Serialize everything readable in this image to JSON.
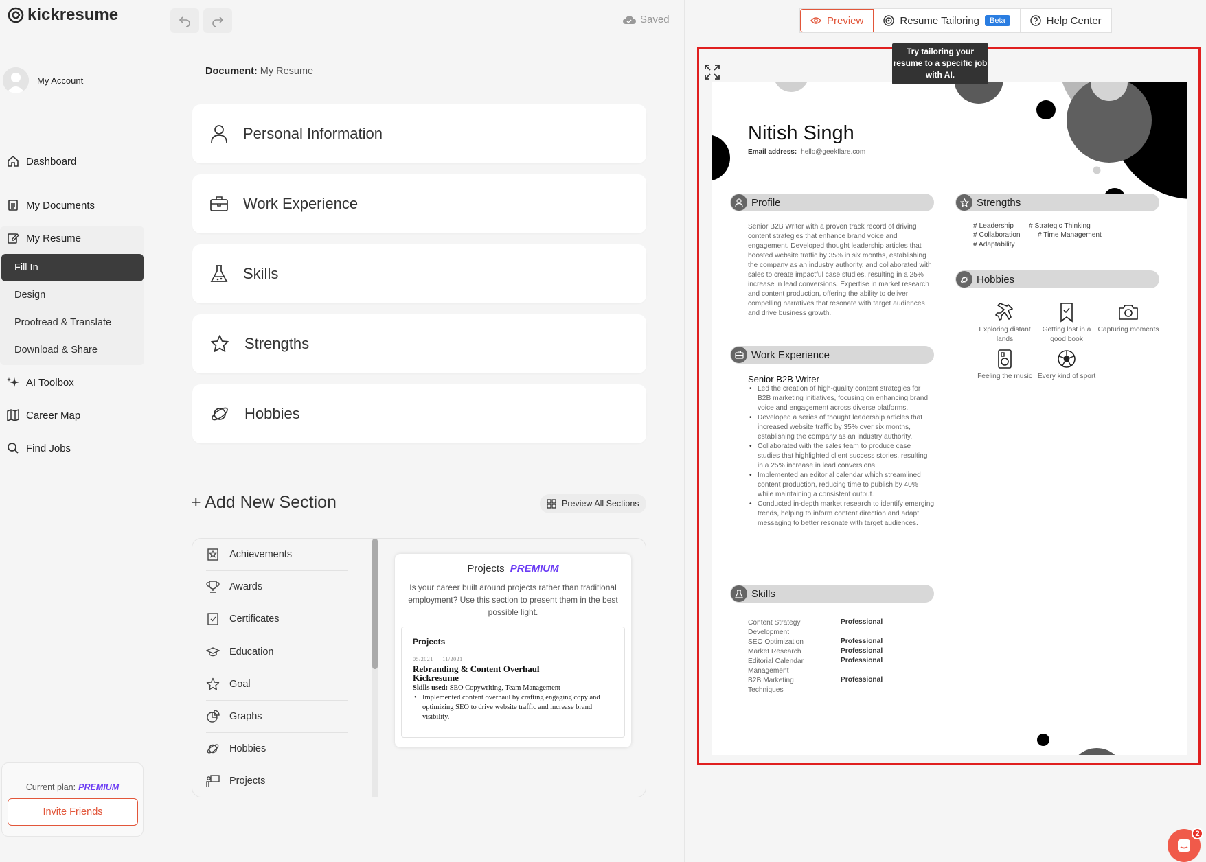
{
  "app": {
    "logo": "kickresume",
    "account_label": "My Account"
  },
  "sidebar": {
    "dashboard": "Dashboard",
    "documents": "My Documents",
    "resume": "My Resume",
    "sub": [
      "Fill In",
      "Design",
      "Proofread & Translate",
      "Download & Share"
    ],
    "ai_toolbox": "AI Toolbox",
    "career_map": "Career Map",
    "find_jobs": "Find Jobs",
    "plan_label": "Current plan:",
    "plan_value": "PREMIUM",
    "invite": "Invite Friends"
  },
  "toolbar": {
    "saved": "Saved"
  },
  "editor": {
    "doc_label": "Document:",
    "doc_name": "My Resume",
    "sections": [
      "Personal Information",
      "Work Experience",
      "Skills",
      "Strengths",
      "Hobbies"
    ],
    "add_section": "+ Add New Section",
    "preview_all": "Preview All Sections",
    "section_list": [
      "Achievements",
      "Awards",
      "Certificates",
      "Education",
      "Goal",
      "Graphs",
      "Hobbies",
      "Projects"
    ],
    "projects_card": {
      "title": "Projects",
      "premium": "PREMIUM",
      "description": "Is your career built around projects rather than traditional employment? Use this section to present them in the best possible light.",
      "sample_heading": "Projects",
      "sample_dates": "05/2021 — 11/2021",
      "sample_title": "Rebranding & Content Overhaul",
      "sample_company": "Kickresume",
      "sample_skills_label": "Skills used:",
      "sample_skills": "SEO Copywriting, Team Management",
      "sample_bullet": "Implemented content overhaul by crafting engaging copy and optimizing SEO to drive website traffic and increase brand visibility."
    }
  },
  "topnav": {
    "preview": "Preview",
    "tailoring": "Resume Tailoring",
    "beta": "Beta",
    "help": "Help Center",
    "tooltip": "Try tailoring your resume to a specific job with AI."
  },
  "resume": {
    "name": "Nitish Singh",
    "email_label": "Email address:",
    "email": "hello@geekflare.com",
    "profile_title": "Profile",
    "profile_text": "Senior B2B Writer with a proven track record of driving content strategies that enhance brand voice and engagement. Developed thought leadership articles that boosted website traffic by 35% in six months, establishing the company as an industry authority, and collaborated with sales to create impactful case studies, resulting in a 25% increase in lead conversions. Expertise in market research and content production, offering the ability to deliver compelling narratives that resonate with target audiences and drive business growth.",
    "work_title": "Work Experience",
    "job_title": "Senior B2B Writer",
    "job_bullets": [
      "Led the creation of high-quality content strategies for B2B marketing initiatives, focusing on enhancing brand voice and engagement across diverse platforms.",
      "Developed a series of thought leadership articles that increased website traffic by 35% over six months, establishing the company as an industry authority.",
      "Collaborated with the sales team to produce case studies that highlighted client success stories, resulting in a 25% increase in lead conversions.",
      "Implemented an editorial calendar which streamlined content production, reducing time to publish by 40% while maintaining a consistent output.",
      "Conducted in-depth market research to identify emerging trends, helping to inform content direction and adapt messaging to better resonate with target audiences."
    ],
    "skills_title": "Skills",
    "skills": [
      {
        "name": "Content Strategy Development",
        "level": "Professional"
      },
      {
        "name": "SEO Optimization",
        "level": "Professional"
      },
      {
        "name": "Market Research",
        "level": "Professional"
      },
      {
        "name": "Editorial Calendar Management",
        "level": "Professional"
      },
      {
        "name": "B2B Marketing Techniques",
        "level": "Professional"
      }
    ],
    "strengths_title": "Strengths",
    "strengths": [
      "# Leadership",
      "# Strategic Thinking",
      "# Collaboration",
      "# Time Management",
      "# Adaptability"
    ],
    "hobbies_title": "Hobbies",
    "hobbies": [
      "Exploring distant lands",
      "Getting lost in a good book",
      "Capturing moments",
      "Feeling the music",
      "Every kind of sport"
    ]
  },
  "chat": {
    "badge": "2"
  }
}
